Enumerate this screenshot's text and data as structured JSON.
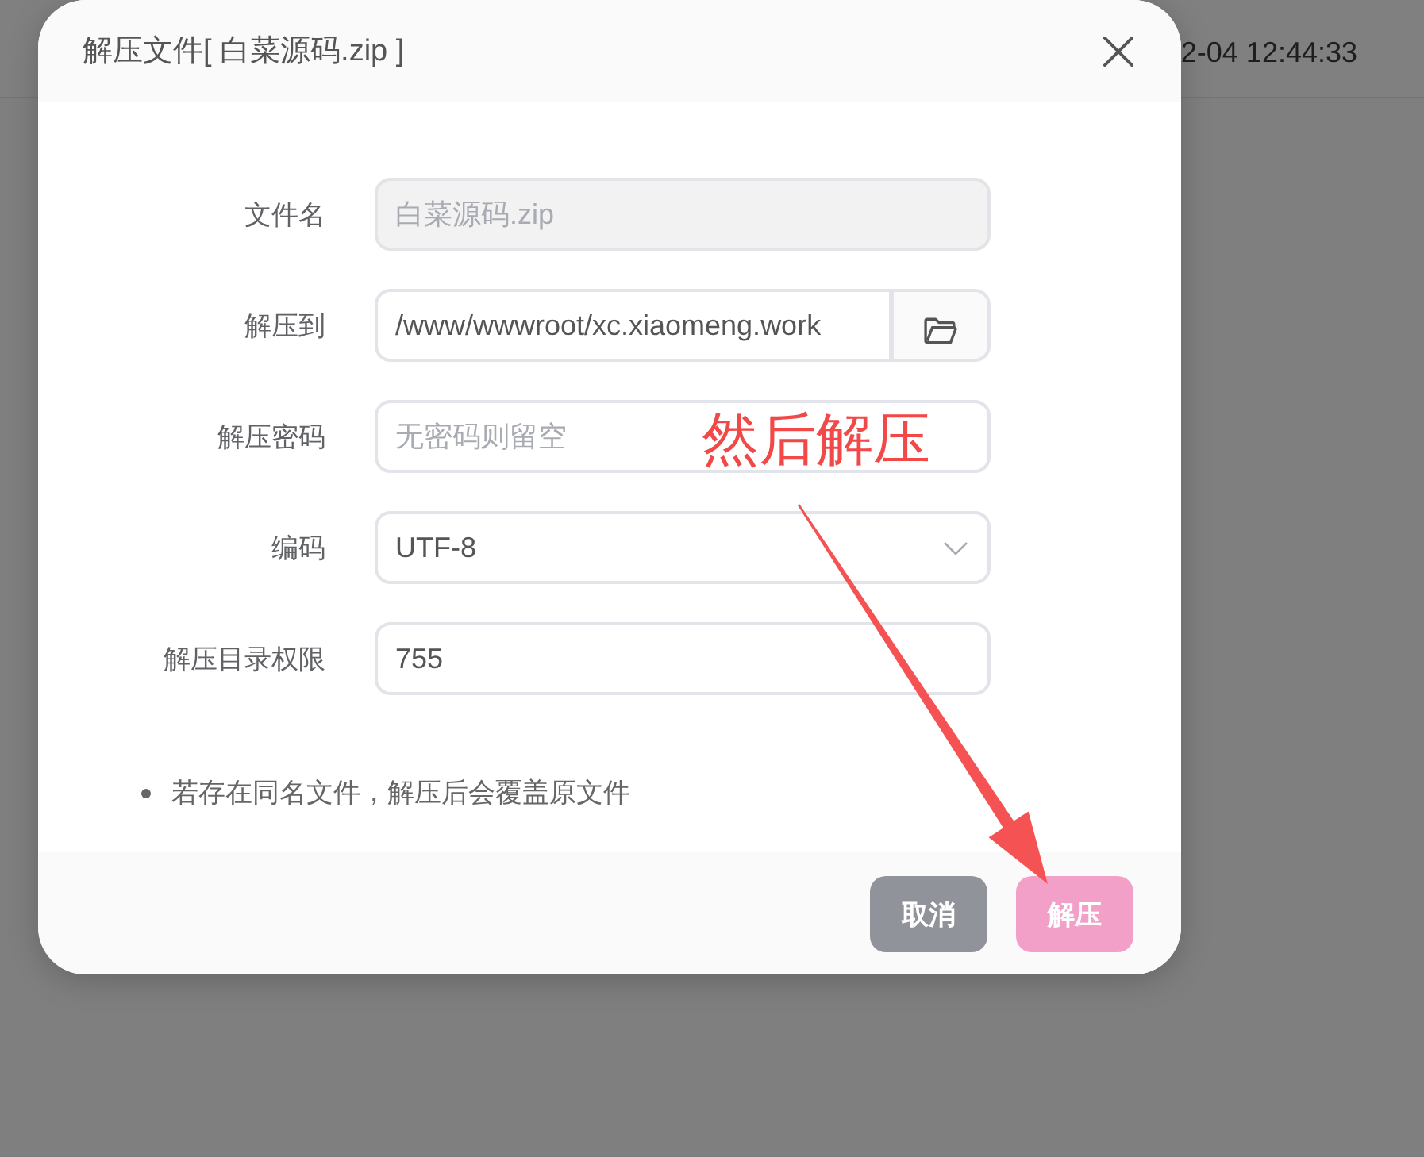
{
  "background": {
    "timestamp": "2-04 12:44:33"
  },
  "dialog": {
    "title": "解压文件[ 白菜源码.zip ]",
    "fields": [
      {
        "kind": "text",
        "label": "文件名",
        "value": "白菜源码.zip",
        "disabled": true
      },
      {
        "kind": "path",
        "label": "解压到",
        "value": "/www/wwwroot/xc.xiaomeng.work",
        "disabled": false
      },
      {
        "kind": "text",
        "label": "解压密码",
        "placeholder": "无密码则留空",
        "disabled": false
      },
      {
        "kind": "select",
        "label": "编码",
        "value": "UTF-8",
        "disabled": false
      },
      {
        "kind": "text",
        "label": "解压目录权限",
        "value": "755",
        "disabled": false
      }
    ],
    "notes": [
      "若存在同名文件，解压后会覆盖原文件"
    ],
    "buttons": [
      {
        "kind": "secondary",
        "label": "取消"
      },
      {
        "kind": "primary",
        "label": "解压"
      }
    ]
  },
  "annotation": {
    "text": "然后解压"
  }
}
